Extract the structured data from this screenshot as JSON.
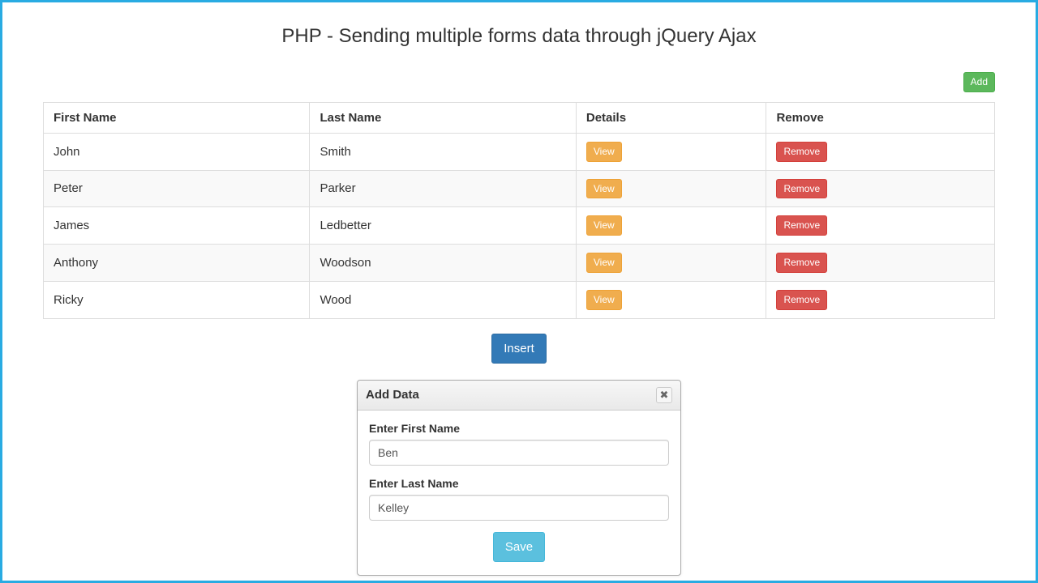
{
  "page": {
    "title": "PHP - Sending multiple forms data through jQuery Ajax"
  },
  "toolbar": {
    "add_label": "Add",
    "insert_label": "Insert"
  },
  "table": {
    "headers": {
      "first_name": "First Name",
      "last_name": "Last Name",
      "details": "Details",
      "remove": "Remove"
    },
    "view_label": "View",
    "remove_label": "Remove",
    "rows": [
      {
        "first_name": "John",
        "last_name": "Smith"
      },
      {
        "first_name": "Peter",
        "last_name": "Parker"
      },
      {
        "first_name": "James",
        "last_name": "Ledbetter"
      },
      {
        "first_name": "Anthony",
        "last_name": "Woodson"
      },
      {
        "first_name": "Ricky",
        "last_name": "Wood"
      }
    ]
  },
  "dialog": {
    "title": "Add Data",
    "first_name_label": "Enter First Name",
    "last_name_label": "Enter Last Name",
    "first_name_value": "Ben",
    "last_name_value": "Kelley",
    "save_label": "Save",
    "close_icon": "✖"
  }
}
